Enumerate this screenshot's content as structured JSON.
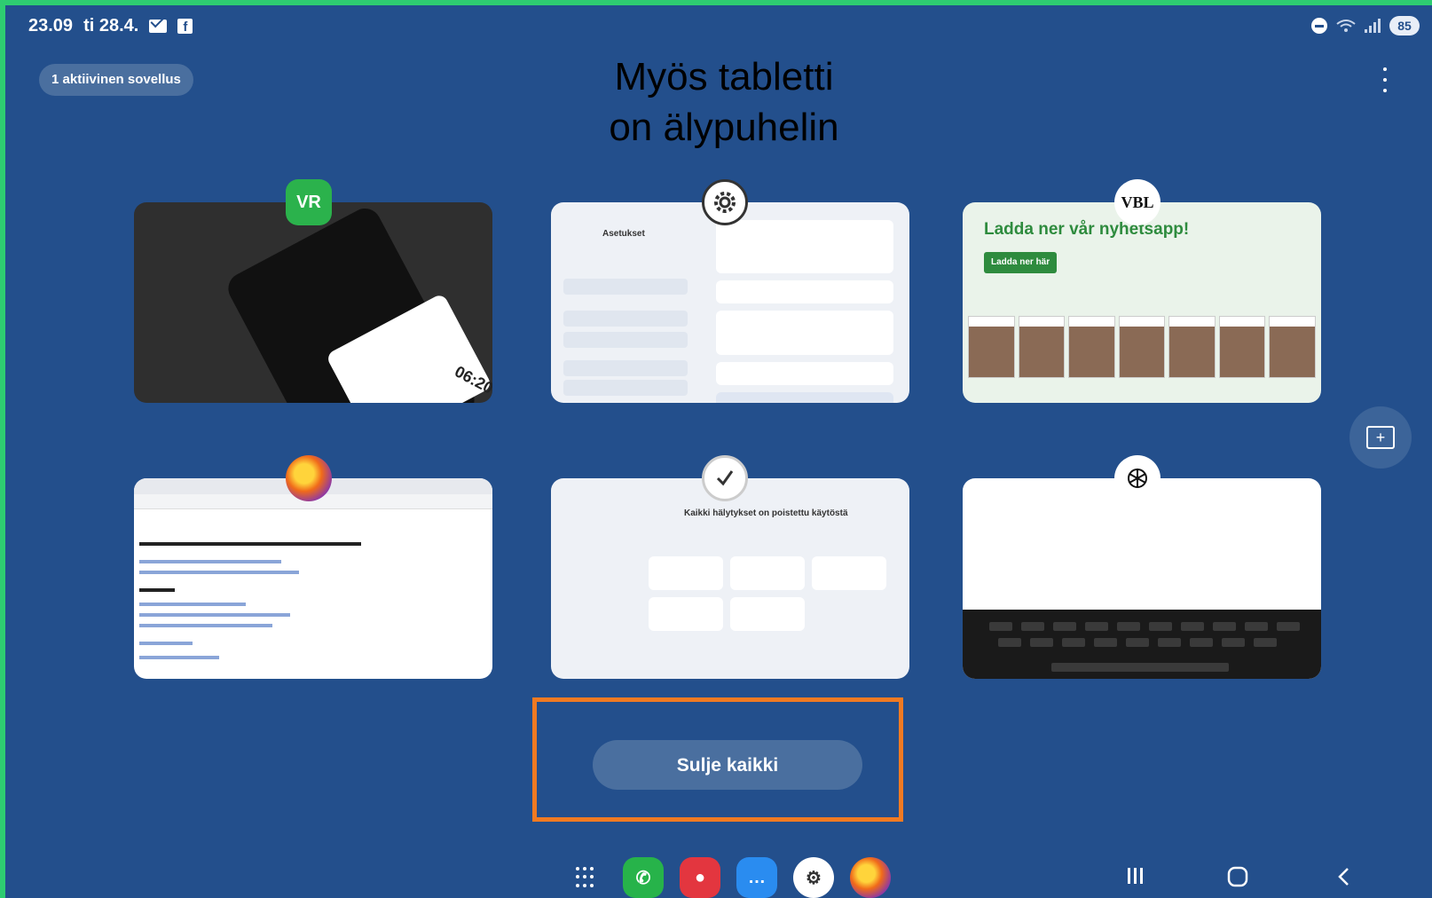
{
  "status_bar": {
    "time": "23.09",
    "date": "ti 28.4.",
    "icons": [
      "mail-icon",
      "facebook-icon"
    ],
    "right_icons": [
      "do-not-disturb-icon",
      "wifi-icon",
      "signal-icon"
    ],
    "battery": "85"
  },
  "recents": {
    "active_apps_label": "1 aktiivinen sovellus",
    "close_all_label": "Sulje kaikki"
  },
  "overlay": {
    "title_line1": "Myös tabletti",
    "title_line2": "on älypuhelin"
  },
  "cards": [
    {
      "app": "VR",
      "icon": "vr-app-icon",
      "color": "#2bb24c",
      "preview_time": "06:20"
    },
    {
      "app": "Asetukset",
      "icon": "settings-icon",
      "preview_title": "Asetukset"
    },
    {
      "app": "VBL",
      "icon": "vbl-icon",
      "preview_headline": "Ladda ner vår nyhetsapp!",
      "preview_button": "Ladda ner här"
    },
    {
      "app": "Firefox",
      "icon": "firefox-icon"
    },
    {
      "app": "Kello",
      "icon": "clock-icon",
      "preview_title": "Kaikki hälytykset on poistettu käytöstä"
    },
    {
      "app": "ChatGPT",
      "icon": "chatgpt-icon"
    }
  ],
  "dock": {
    "items": [
      "apps-grid-icon",
      "phone-icon",
      "contacts-icon",
      "messages-icon",
      "settings-icon",
      "firefox-icon"
    ],
    "colors": {
      "phone": "#27b34a",
      "contacts": "#e3363f",
      "messages": "#2a8cf0",
      "settings": "#ffffff",
      "firefox": "#f06a1a"
    }
  },
  "nav_bar": [
    "recents-icon",
    "home-icon",
    "back-icon"
  ],
  "colors": {
    "background": "#234f8c",
    "frame": "#2ecc71",
    "highlight": "#f07a22"
  }
}
